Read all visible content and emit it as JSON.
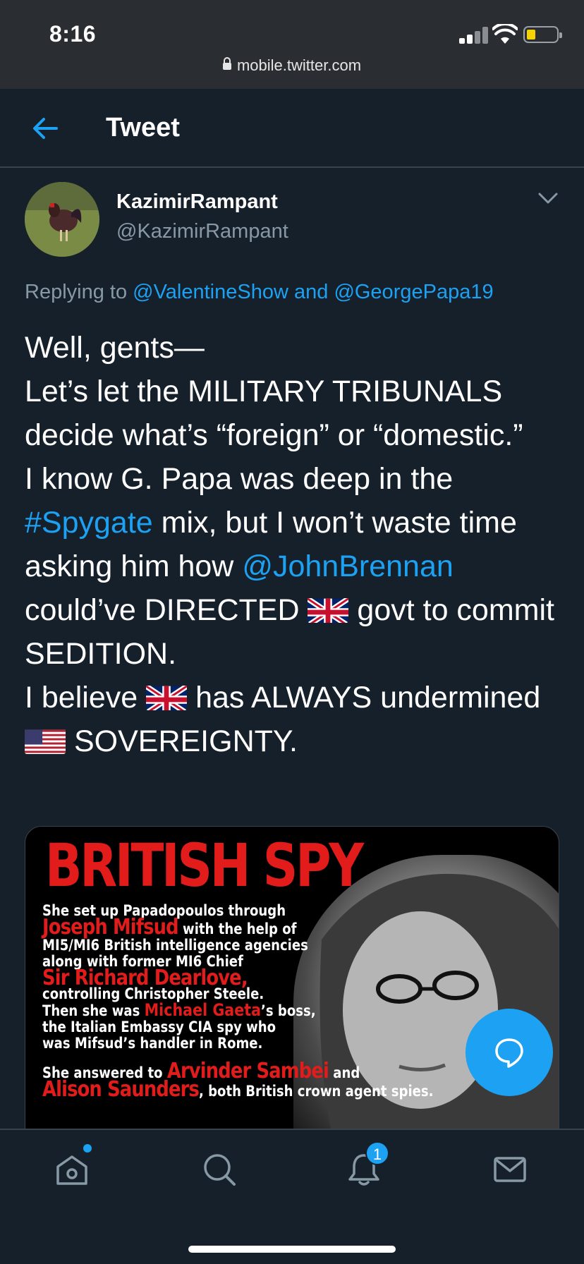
{
  "status_bar": {
    "time": "8:16",
    "url": "mobile.twitter.com"
  },
  "header": {
    "title": "Tweet"
  },
  "tweet": {
    "display_name": "KazimirRampant",
    "handle": "@KazimirRampant",
    "replying_to_prefix": "Replying to",
    "replying_to_user1": "@ValentineShow",
    "replying_to_and": "and",
    "replying_to_user2": "@GeorgePapa19",
    "line1": "Well, gents—",
    "line2": "Let’s let the MILITARY TRIBUNALS decide what’s “foreign” or “domestic.”",
    "line3a": "I know G. Papa was deep in the",
    "hashtag": "#Spygate",
    "line3b": "mix, but I won’t waste time asking him how",
    "mention": "@JohnBrennan",
    "line3c": "could’ve DIRECTED",
    "line3d": "govt to commit SEDITION.",
    "line4a": "I believe",
    "line4b": "has ALWAYS undermined",
    "line4c": "SOVEREIGNTY."
  },
  "media": {
    "title": "BRITISH SPY",
    "l1": "She set up Papadopoulos through",
    "l2_red": "Joseph Mifsud",
    "l2": " with the help of",
    "l3": "MI5/MI6 British intelligence agencies",
    "l4": "along with former MI6 Chief",
    "l5_red": "Sir Richard Dearlove,",
    "l6": "controlling Christopher Steele.",
    "l7a": "Then she was ",
    "l7_red": "Michael Gaeta",
    "l7b": "’s boss,",
    "l8": "the Italian Embassy  CIA spy who",
    "l9": "was Mifsud’s handler in Rome.",
    "l10a": "She answered to ",
    "l10_red": "Arvinder Sambei",
    "l10b": " and",
    "l11_red": "Alison Saunders",
    "l11b": ", both British crown agent spies."
  },
  "tabbar": {
    "notifications_count": "1"
  },
  "colors": {
    "background": "#15202b",
    "accent": "#1da1f2",
    "secondary_text": "#8899a6"
  },
  "icons": [
    "back-arrow-icon",
    "chevron-down-icon",
    "reply-bubble-icon",
    "home-icon",
    "search-icon",
    "bell-icon",
    "mail-icon",
    "uk-flag-icon",
    "us-flag-icon"
  ]
}
